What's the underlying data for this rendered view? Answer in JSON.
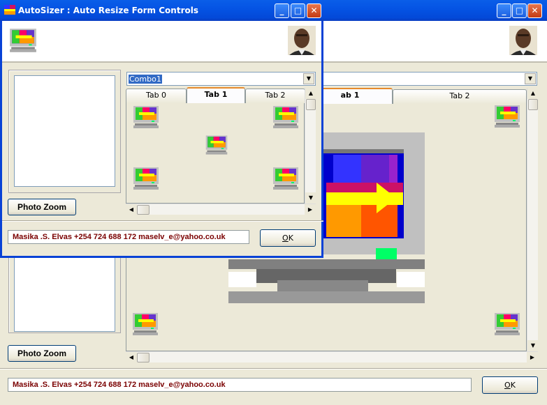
{
  "window": {
    "title": "AutoSizer : Auto Resize Form Controls"
  },
  "combo": {
    "value": "Combo1"
  },
  "tabs": [
    {
      "label": "Tab 0"
    },
    {
      "label": "Tab 1"
    },
    {
      "label": "Tab 2"
    }
  ],
  "back_tabs": [
    {
      "label": "ab 1"
    },
    {
      "label": "Tab 2"
    }
  ],
  "buttons": {
    "photo_zoom": "Photo Zoom",
    "ok": "OK",
    "ok_accel": "O",
    "ok_rest": "K"
  },
  "status": {
    "text": "Masika .S. Elvas +254 724 688 172 maselv_e@yahoo.co.uk"
  },
  "colors": {
    "titlebar": "#0554e4",
    "status_text": "#7a0000",
    "tab_accent": "#e68b2c"
  },
  "icons": [
    "app-icon",
    "monitor-icon",
    "avatar",
    "minimize-icon",
    "maximize-icon",
    "close-icon"
  ]
}
